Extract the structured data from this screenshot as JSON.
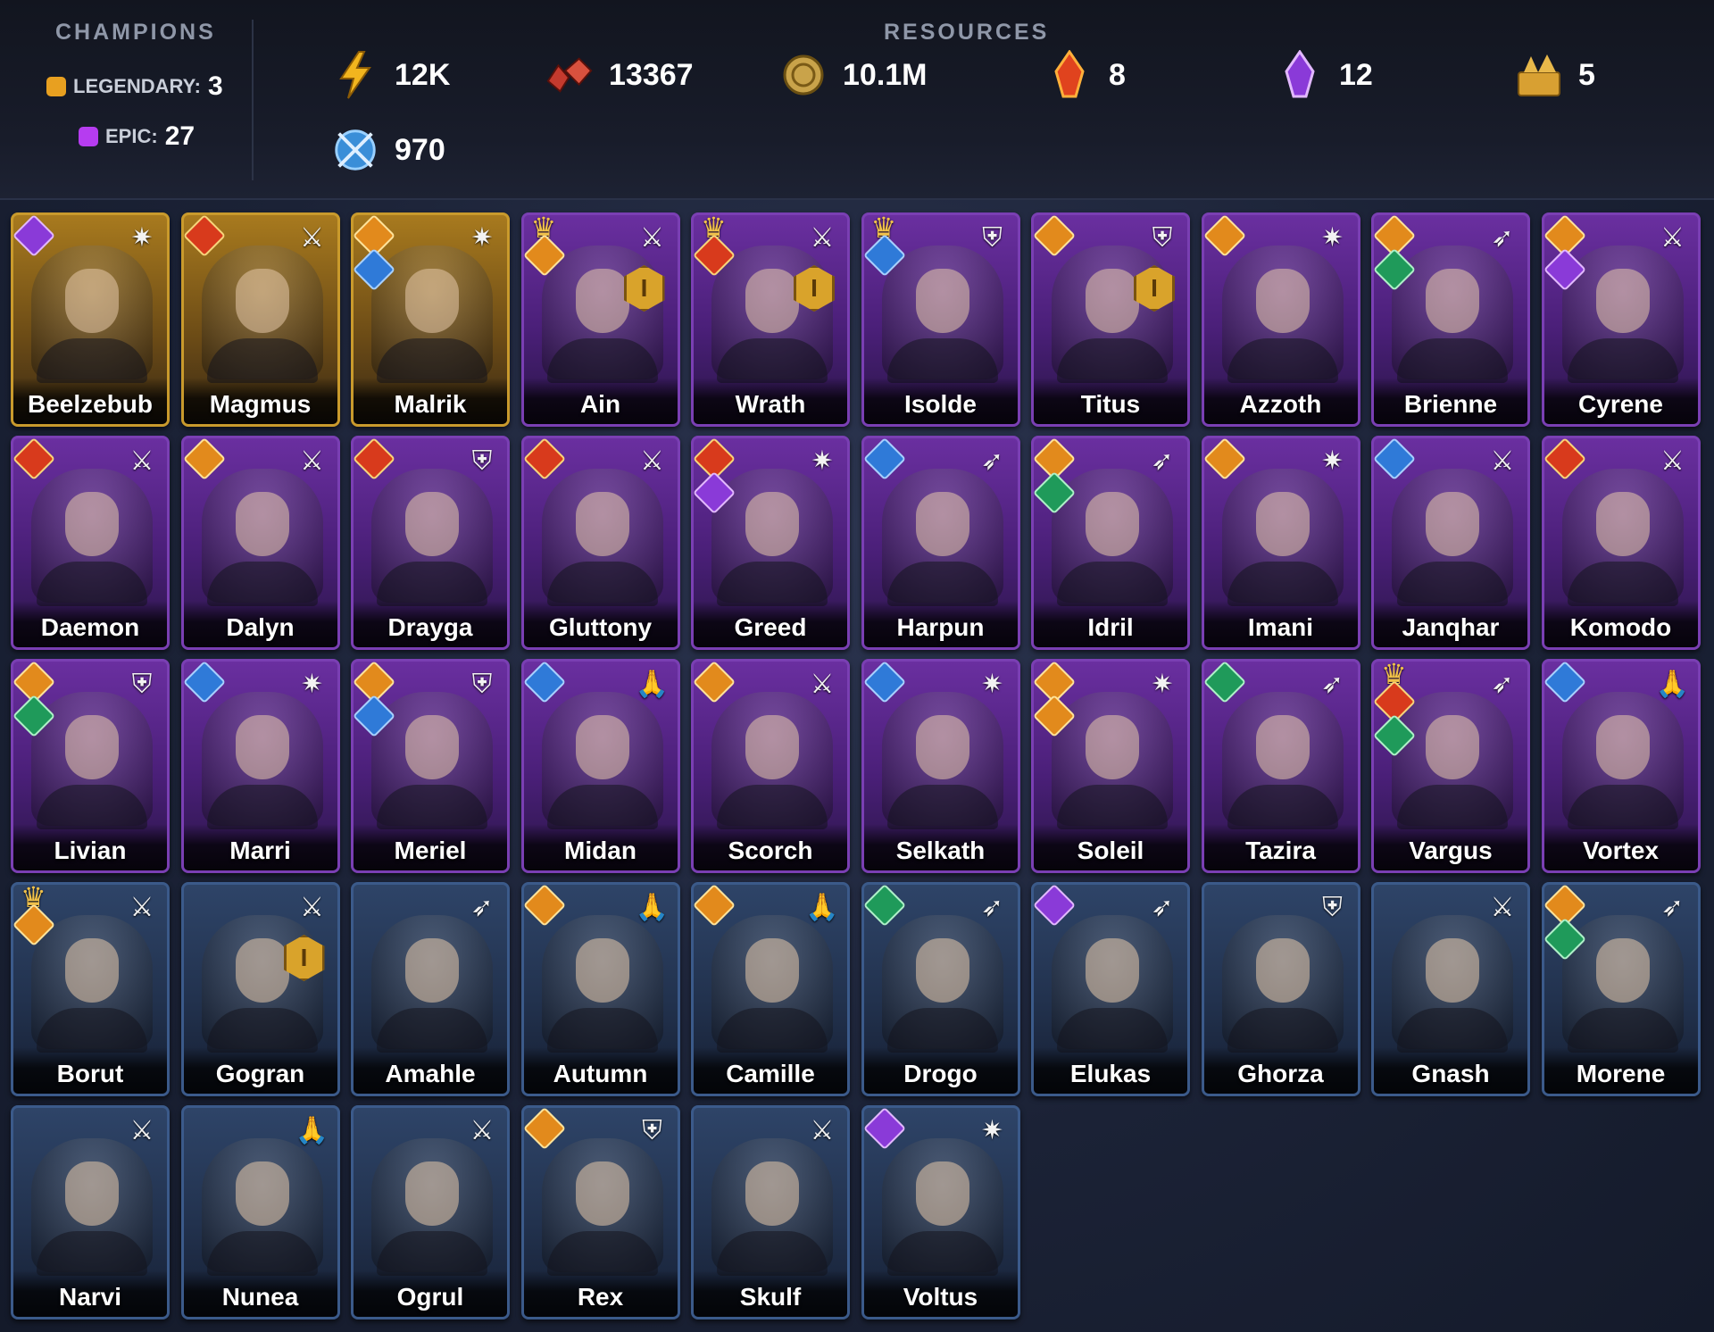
{
  "header": {
    "champions_title": "CHAMPIONS",
    "resources_title": "RESOURCES",
    "legendary_label": "LEGENDARY:",
    "legendary_count": "3",
    "epic_label": "EPIC:",
    "epic_count": "27",
    "colors": {
      "legendary": "#e8a020",
      "epic": "#b63cf0"
    }
  },
  "resources": [
    {
      "icon": "energy-lightning-icon",
      "value": "12K"
    },
    {
      "icon": "gems-icon",
      "value": "13367"
    },
    {
      "icon": "silver-coin-icon",
      "value": "10.1M"
    },
    {
      "icon": "red-shard-icon",
      "value": "8"
    },
    {
      "icon": "purple-shard-icon",
      "value": "12"
    },
    {
      "icon": "gold-tokens-icon",
      "value": "5"
    },
    {
      "icon": "arena-token-icon",
      "value": "970"
    }
  ],
  "champions": [
    {
      "name": "Beelzebub",
      "rarity": "legendary",
      "role_icon": "wand-icon",
      "factions": [
        "purple"
      ],
      "crown": false,
      "badge": ""
    },
    {
      "name": "Magmus",
      "rarity": "legendary",
      "role_icon": "sword-icon",
      "factions": [
        "red"
      ],
      "crown": false,
      "badge": ""
    },
    {
      "name": "Malrik",
      "rarity": "legendary",
      "role_icon": "wand-icon",
      "factions": [
        "orange",
        "blue"
      ],
      "crown": false,
      "badge": ""
    },
    {
      "name": "Ain",
      "rarity": "epic",
      "role_icon": "sword-icon",
      "factions": [
        "orange"
      ],
      "crown": true,
      "badge": "I"
    },
    {
      "name": "Wrath",
      "rarity": "epic",
      "role_icon": "sword-icon",
      "factions": [
        "red"
      ],
      "crown": true,
      "badge": "I"
    },
    {
      "name": "Isolde",
      "rarity": "epic",
      "role_icon": "shield-icon",
      "factions": [
        "blue"
      ],
      "crown": true,
      "badge": ""
    },
    {
      "name": "Titus",
      "rarity": "epic",
      "role_icon": "shield-icon",
      "factions": [
        "orange"
      ],
      "crown": false,
      "badge": "I"
    },
    {
      "name": "Azzoth",
      "rarity": "epic",
      "role_icon": "wand-icon",
      "factions": [
        "orange"
      ],
      "crown": false,
      "badge": ""
    },
    {
      "name": "Brienne",
      "rarity": "epic",
      "role_icon": "crossed-arrows-icon",
      "factions": [
        "orange",
        "green"
      ],
      "crown": false,
      "badge": ""
    },
    {
      "name": "Cyrene",
      "rarity": "epic",
      "role_icon": "sword-icon",
      "factions": [
        "orange",
        "purple"
      ],
      "crown": false,
      "badge": ""
    },
    {
      "name": "Daemon",
      "rarity": "epic",
      "role_icon": "sword-icon",
      "factions": [
        "red"
      ],
      "crown": false,
      "badge": ""
    },
    {
      "name": "Dalyn",
      "rarity": "epic",
      "role_icon": "sword-icon",
      "factions": [
        "orange"
      ],
      "crown": false,
      "badge": ""
    },
    {
      "name": "Drayga",
      "rarity": "epic",
      "role_icon": "shield-icon",
      "factions": [
        "red"
      ],
      "crown": false,
      "badge": ""
    },
    {
      "name": "Gluttony",
      "rarity": "epic",
      "role_icon": "sword-icon",
      "factions": [
        "red"
      ],
      "crown": false,
      "badge": ""
    },
    {
      "name": "Greed",
      "rarity": "epic",
      "role_icon": "wand-icon",
      "factions": [
        "red",
        "purple"
      ],
      "crown": false,
      "badge": ""
    },
    {
      "name": "Harpun",
      "rarity": "epic",
      "role_icon": "crossed-arrows-icon",
      "factions": [
        "blue"
      ],
      "crown": false,
      "badge": ""
    },
    {
      "name": "Idril",
      "rarity": "epic",
      "role_icon": "crossed-arrows-icon",
      "factions": [
        "orange",
        "green"
      ],
      "crown": false,
      "badge": ""
    },
    {
      "name": "Imani",
      "rarity": "epic",
      "role_icon": "wand-icon",
      "factions": [
        "orange"
      ],
      "crown": false,
      "badge": ""
    },
    {
      "name": "Janqhar",
      "rarity": "epic",
      "role_icon": "sword-icon",
      "factions": [
        "blue"
      ],
      "crown": false,
      "badge": ""
    },
    {
      "name": "Komodo",
      "rarity": "epic",
      "role_icon": "sword-icon",
      "factions": [
        "red"
      ],
      "crown": false,
      "badge": ""
    },
    {
      "name": "Livian",
      "rarity": "epic",
      "role_icon": "shield-icon",
      "factions": [
        "orange",
        "green"
      ],
      "crown": false,
      "badge": ""
    },
    {
      "name": "Marri",
      "rarity": "epic",
      "role_icon": "wand-icon",
      "factions": [
        "blue"
      ],
      "crown": false,
      "badge": ""
    },
    {
      "name": "Meriel",
      "rarity": "epic",
      "role_icon": "shield-icon",
      "factions": [
        "orange",
        "blue"
      ],
      "crown": false,
      "badge": ""
    },
    {
      "name": "Midan",
      "rarity": "epic",
      "role_icon": "praying-hands-icon",
      "factions": [
        "blue"
      ],
      "crown": false,
      "badge": ""
    },
    {
      "name": "Scorch",
      "rarity": "epic",
      "role_icon": "sword-icon",
      "factions": [
        "orange"
      ],
      "crown": false,
      "badge": ""
    },
    {
      "name": "Selkath",
      "rarity": "epic",
      "role_icon": "wand-icon",
      "factions": [
        "blue"
      ],
      "crown": false,
      "badge": ""
    },
    {
      "name": "Soleil",
      "rarity": "epic",
      "role_icon": "wand-icon",
      "factions": [
        "orange",
        "orange"
      ],
      "crown": false,
      "badge": ""
    },
    {
      "name": "Tazira",
      "rarity": "epic",
      "role_icon": "crossed-arrows-icon",
      "factions": [
        "green"
      ],
      "crown": false,
      "badge": ""
    },
    {
      "name": "Vargus",
      "rarity": "epic",
      "role_icon": "crossed-arrows-icon",
      "factions": [
        "red",
        "green"
      ],
      "crown": true,
      "badge": ""
    },
    {
      "name": "Vortex",
      "rarity": "epic",
      "role_icon": "praying-hands-icon",
      "factions": [
        "blue"
      ],
      "crown": false,
      "badge": ""
    },
    {
      "name": "Borut",
      "rarity": "rare",
      "role_icon": "sword-icon",
      "factions": [
        "orange"
      ],
      "crown": true,
      "badge": ""
    },
    {
      "name": "Gogran",
      "rarity": "rare",
      "role_icon": "sword-icon",
      "factions": [],
      "crown": false,
      "badge": "I"
    },
    {
      "name": "Amahle",
      "rarity": "rare",
      "role_icon": "crossed-arrows-icon",
      "factions": [],
      "crown": false,
      "badge": ""
    },
    {
      "name": "Autumn",
      "rarity": "rare",
      "role_icon": "praying-hands-icon",
      "factions": [
        "orange"
      ],
      "crown": false,
      "badge": ""
    },
    {
      "name": "Camille",
      "rarity": "rare",
      "role_icon": "praying-hands-icon",
      "factions": [
        "orange"
      ],
      "crown": false,
      "badge": ""
    },
    {
      "name": "Drogo",
      "rarity": "rare",
      "role_icon": "crossed-arrows-icon",
      "factions": [
        "green"
      ],
      "crown": false,
      "badge": ""
    },
    {
      "name": "Elukas",
      "rarity": "rare",
      "role_icon": "crossed-arrows-icon",
      "factions": [
        "purple"
      ],
      "crown": false,
      "badge": ""
    },
    {
      "name": "Ghorza",
      "rarity": "rare",
      "role_icon": "shield-icon",
      "factions": [],
      "crown": false,
      "badge": ""
    },
    {
      "name": "Gnash",
      "rarity": "rare",
      "role_icon": "sword-icon",
      "factions": [],
      "crown": false,
      "badge": ""
    },
    {
      "name": "Morene",
      "rarity": "rare",
      "role_icon": "crossed-arrows-icon",
      "factions": [
        "orange",
        "green"
      ],
      "crown": false,
      "badge": ""
    },
    {
      "name": "Narvi",
      "rarity": "rare",
      "role_icon": "sword-icon",
      "factions": [],
      "crown": false,
      "badge": ""
    },
    {
      "name": "Nunea",
      "rarity": "rare",
      "role_icon": "praying-hands-icon",
      "factions": [],
      "crown": false,
      "badge": ""
    },
    {
      "name": "Ogrul",
      "rarity": "rare",
      "role_icon": "sword-icon",
      "factions": [],
      "crown": false,
      "badge": ""
    },
    {
      "name": "Rex",
      "rarity": "rare",
      "role_icon": "shield-icon",
      "factions": [
        "orange"
      ],
      "crown": false,
      "badge": ""
    },
    {
      "name": "Skulf",
      "rarity": "rare",
      "role_icon": "sword-icon",
      "factions": [],
      "crown": false,
      "badge": ""
    },
    {
      "name": "Voltus",
      "rarity": "rare",
      "role_icon": "wand-icon",
      "factions": [
        "purple"
      ],
      "crown": false,
      "badge": ""
    }
  ]
}
